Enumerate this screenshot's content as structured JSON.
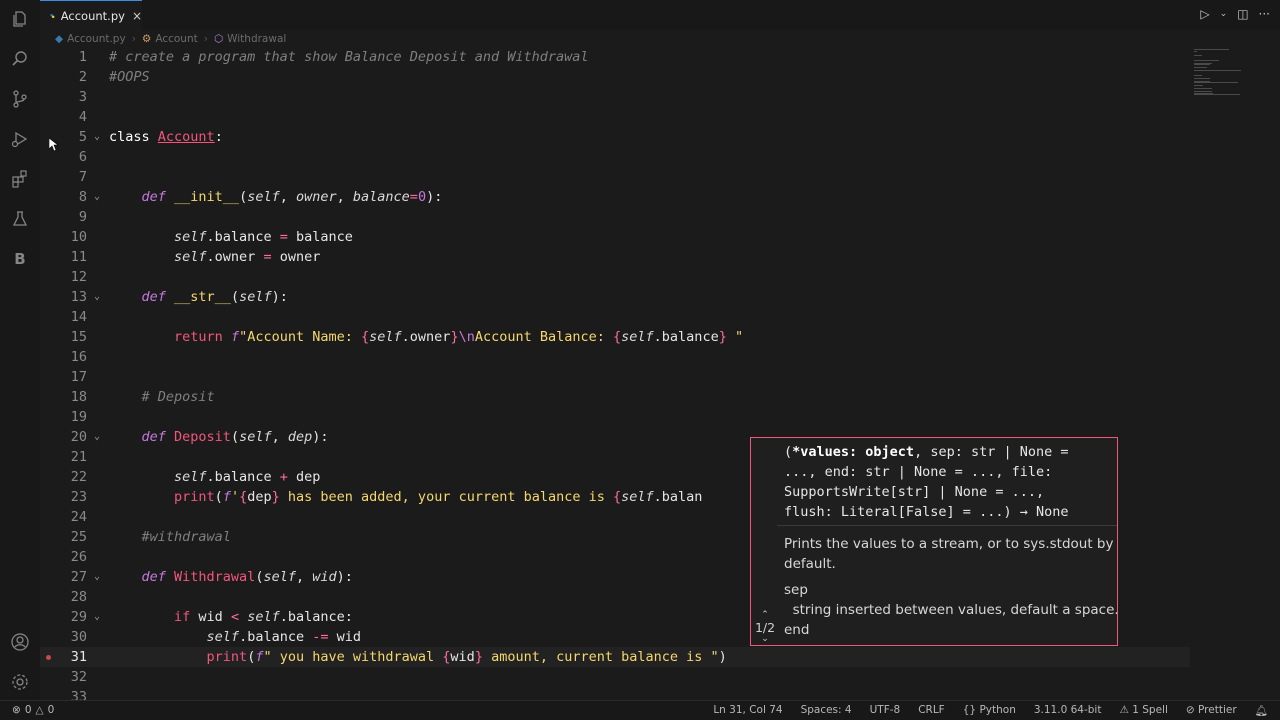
{
  "tab": {
    "filename": "Account.py",
    "close": "×"
  },
  "breadcrumb": [
    "Account.py",
    "Account",
    "Withdrawal"
  ],
  "code_lines": [
    {
      "n": "1",
      "code": [
        {
          "t": "# create a program that show Balance Deposit and Withdrawal",
          "c": "c-com"
        }
      ]
    },
    {
      "n": "2",
      "code": [
        {
          "t": "#OOPS",
          "c": "c-com"
        }
      ]
    },
    {
      "n": "3",
      "code": []
    },
    {
      "n": "4",
      "code": []
    },
    {
      "n": "5",
      "fold": true,
      "code": [
        {
          "t": "class ",
          "c": "c-kw"
        },
        {
          "t": "Account",
          "c": "c-cls"
        },
        {
          "t": ":",
          "c": "c-plain"
        }
      ]
    },
    {
      "n": "6",
      "code": []
    },
    {
      "n": "7",
      "code": []
    },
    {
      "n": "8",
      "fold": true,
      "code": [
        {
          "t": "    "
        },
        {
          "t": "def ",
          "c": "c-def"
        },
        {
          "t": "__init__",
          "c": "c-fn"
        },
        {
          "t": "(",
          "c": "c-plain"
        },
        {
          "t": "self",
          "c": "c-self"
        },
        {
          "t": ", ",
          "c": "c-plain"
        },
        {
          "t": "owner",
          "c": "c-param"
        },
        {
          "t": ", ",
          "c": "c-plain"
        },
        {
          "t": "balance",
          "c": "c-param"
        },
        {
          "t": "=",
          "c": "c-op"
        },
        {
          "t": "0",
          "c": "c-num"
        },
        {
          "t": "):",
          "c": "c-plain"
        }
      ]
    },
    {
      "n": "9",
      "code": []
    },
    {
      "n": "10",
      "code": [
        {
          "t": "        "
        },
        {
          "t": "self",
          "c": "c-self"
        },
        {
          "t": ".balance ",
          "c": "c-plain"
        },
        {
          "t": "=",
          "c": "c-op"
        },
        {
          "t": " balance",
          "c": "c-plain"
        }
      ]
    },
    {
      "n": "11",
      "code": [
        {
          "t": "        "
        },
        {
          "t": "self",
          "c": "c-self"
        },
        {
          "t": ".owner ",
          "c": "c-plain"
        },
        {
          "t": "=",
          "c": "c-op"
        },
        {
          "t": " owner",
          "c": "c-plain"
        }
      ]
    },
    {
      "n": "12",
      "code": []
    },
    {
      "n": "13",
      "fold": true,
      "code": [
        {
          "t": "    "
        },
        {
          "t": "def ",
          "c": "c-def"
        },
        {
          "t": "__str__",
          "c": "c-fn"
        },
        {
          "t": "(",
          "c": "c-plain"
        },
        {
          "t": "self",
          "c": "c-self"
        },
        {
          "t": "):",
          "c": "c-plain"
        }
      ]
    },
    {
      "n": "14",
      "code": []
    },
    {
      "n": "15",
      "code": [
        {
          "t": "        "
        },
        {
          "t": "return ",
          "c": "c-ret"
        },
        {
          "t": "f",
          "c": "c-def"
        },
        {
          "t": "\"Account Name: ",
          "c": "c-str"
        },
        {
          "t": "{",
          "c": "c-brace"
        },
        {
          "t": "self",
          "c": "c-self"
        },
        {
          "t": ".owner",
          "c": "c-plain"
        },
        {
          "t": "}",
          "c": "c-brace"
        },
        {
          "t": "\\n",
          "c": "c-esc"
        },
        {
          "t": "Account Balance: ",
          "c": "c-str"
        },
        {
          "t": "{",
          "c": "c-brace"
        },
        {
          "t": "self",
          "c": "c-self"
        },
        {
          "t": ".balance",
          "c": "c-plain"
        },
        {
          "t": "}",
          "c": "c-brace"
        },
        {
          "t": " \"",
          "c": "c-str"
        }
      ]
    },
    {
      "n": "16",
      "code": []
    },
    {
      "n": "17",
      "code": []
    },
    {
      "n": "18",
      "code": [
        {
          "t": "    "
        },
        {
          "t": "# Deposit",
          "c": "c-com"
        }
      ]
    },
    {
      "n": "19",
      "code": []
    },
    {
      "n": "20",
      "fold": true,
      "code": [
        {
          "t": "    "
        },
        {
          "t": "def ",
          "c": "c-def"
        },
        {
          "t": "Deposit",
          "c": "c-ret"
        },
        {
          "t": "(",
          "c": "c-plain"
        },
        {
          "t": "self",
          "c": "c-self"
        },
        {
          "t": ", ",
          "c": "c-plain"
        },
        {
          "t": "dep",
          "c": "c-param"
        },
        {
          "t": "):",
          "c": "c-plain"
        }
      ]
    },
    {
      "n": "21",
      "code": []
    },
    {
      "n": "22",
      "code": [
        {
          "t": "        "
        },
        {
          "t": "self",
          "c": "c-self"
        },
        {
          "t": ".balance ",
          "c": "c-plain"
        },
        {
          "t": "+",
          "c": "c-op"
        },
        {
          "t": " dep",
          "c": "c-plain"
        }
      ]
    },
    {
      "n": "23",
      "code": [
        {
          "t": "        "
        },
        {
          "t": "print",
          "c": "c-print"
        },
        {
          "t": "(",
          "c": "c-plain"
        },
        {
          "t": "f",
          "c": "c-def"
        },
        {
          "t": "'",
          "c": "c-str"
        },
        {
          "t": "{",
          "c": "c-brace"
        },
        {
          "t": "dep",
          "c": "c-plain"
        },
        {
          "t": "}",
          "c": "c-brace"
        },
        {
          "t": " has been added, your current balance is ",
          "c": "c-str"
        },
        {
          "t": "{",
          "c": "c-brace"
        },
        {
          "t": "self",
          "c": "c-self"
        },
        {
          "t": ".balan",
          "c": "c-plain"
        }
      ]
    },
    {
      "n": "24",
      "code": []
    },
    {
      "n": "25",
      "code": [
        {
          "t": "    "
        },
        {
          "t": "#withdrawal",
          "c": "c-com"
        }
      ]
    },
    {
      "n": "26",
      "code": []
    },
    {
      "n": "27",
      "fold": true,
      "code": [
        {
          "t": "    "
        },
        {
          "t": "def ",
          "c": "c-def"
        },
        {
          "t": "Withdrawal",
          "c": "c-ret"
        },
        {
          "t": "(",
          "c": "c-plain"
        },
        {
          "t": "self",
          "c": "c-self"
        },
        {
          "t": ", ",
          "c": "c-plain"
        },
        {
          "t": "wid",
          "c": "c-param"
        },
        {
          "t": "):",
          "c": "c-plain"
        }
      ]
    },
    {
      "n": "28",
      "code": []
    },
    {
      "n": "29",
      "fold": true,
      "code": [
        {
          "t": "        "
        },
        {
          "t": "if ",
          "c": "c-ret"
        },
        {
          "t": "wid ",
          "c": "c-plain"
        },
        {
          "t": "<",
          "c": "c-op"
        },
        {
          "t": " ",
          "c": "c-plain"
        },
        {
          "t": "self",
          "c": "c-self"
        },
        {
          "t": ".balance:",
          "c": "c-plain"
        }
      ]
    },
    {
      "n": "30",
      "code": [
        {
          "t": "            "
        },
        {
          "t": "self",
          "c": "c-self"
        },
        {
          "t": ".balance ",
          "c": "c-plain"
        },
        {
          "t": "-=",
          "c": "c-op"
        },
        {
          "t": " wid",
          "c": "c-plain"
        }
      ]
    },
    {
      "n": "31",
      "current": true,
      "code": [
        {
          "t": "            "
        },
        {
          "t": "print",
          "c": "c-print"
        },
        {
          "t": "(",
          "c": "c-plain"
        },
        {
          "t": "f",
          "c": "c-def"
        },
        {
          "t": "\" you have withdrawal ",
          "c": "c-str"
        },
        {
          "t": "{",
          "c": "c-brace"
        },
        {
          "t": "wid",
          "c": "c-plain"
        },
        {
          "t": "}",
          "c": "c-brace"
        },
        {
          "t": " amount, current balance is \"",
          "c": "c-str"
        },
        {
          "t": ")",
          "c": "c-plain"
        }
      ]
    },
    {
      "n": "32",
      "code": []
    },
    {
      "n": "33",
      "code": []
    }
  ],
  "hover": {
    "signature": [
      "(*values: object, sep: str | None =",
      " ..., end: str | None = ..., file:",
      "SupportsWrite[str] | None = ...,",
      "flush: Literal[False] = ...) → None"
    ],
    "sig_bold": "*values: object",
    "doc_lines": [
      "Prints the values to a stream, or to sys.stdout by",
      "default.",
      "",
      "sep",
      "  string inserted between values, default a space.",
      "end"
    ],
    "pager": "1/2"
  },
  "status": {
    "errors": "0",
    "warnings": "0",
    "position": "Ln 31, Col 74",
    "spaces": "Spaces: 4",
    "encoding": "UTF-8",
    "eol": "CRLF",
    "language": "Python",
    "interpreter": "3.11.0 64-bit",
    "spell": "1 Spell",
    "prettier": "Prettier"
  },
  "activity_icons": [
    "explorer-icon",
    "search-icon",
    "source-control-icon",
    "run-debug-icon",
    "extensions-icon",
    "testing-icon",
    "b-icon",
    "account-icon",
    "settings-gear-icon"
  ],
  "colors": {
    "accent": "#f2567d",
    "tab_border": "#3c8fe0",
    "background": "#1b1b1b"
  }
}
